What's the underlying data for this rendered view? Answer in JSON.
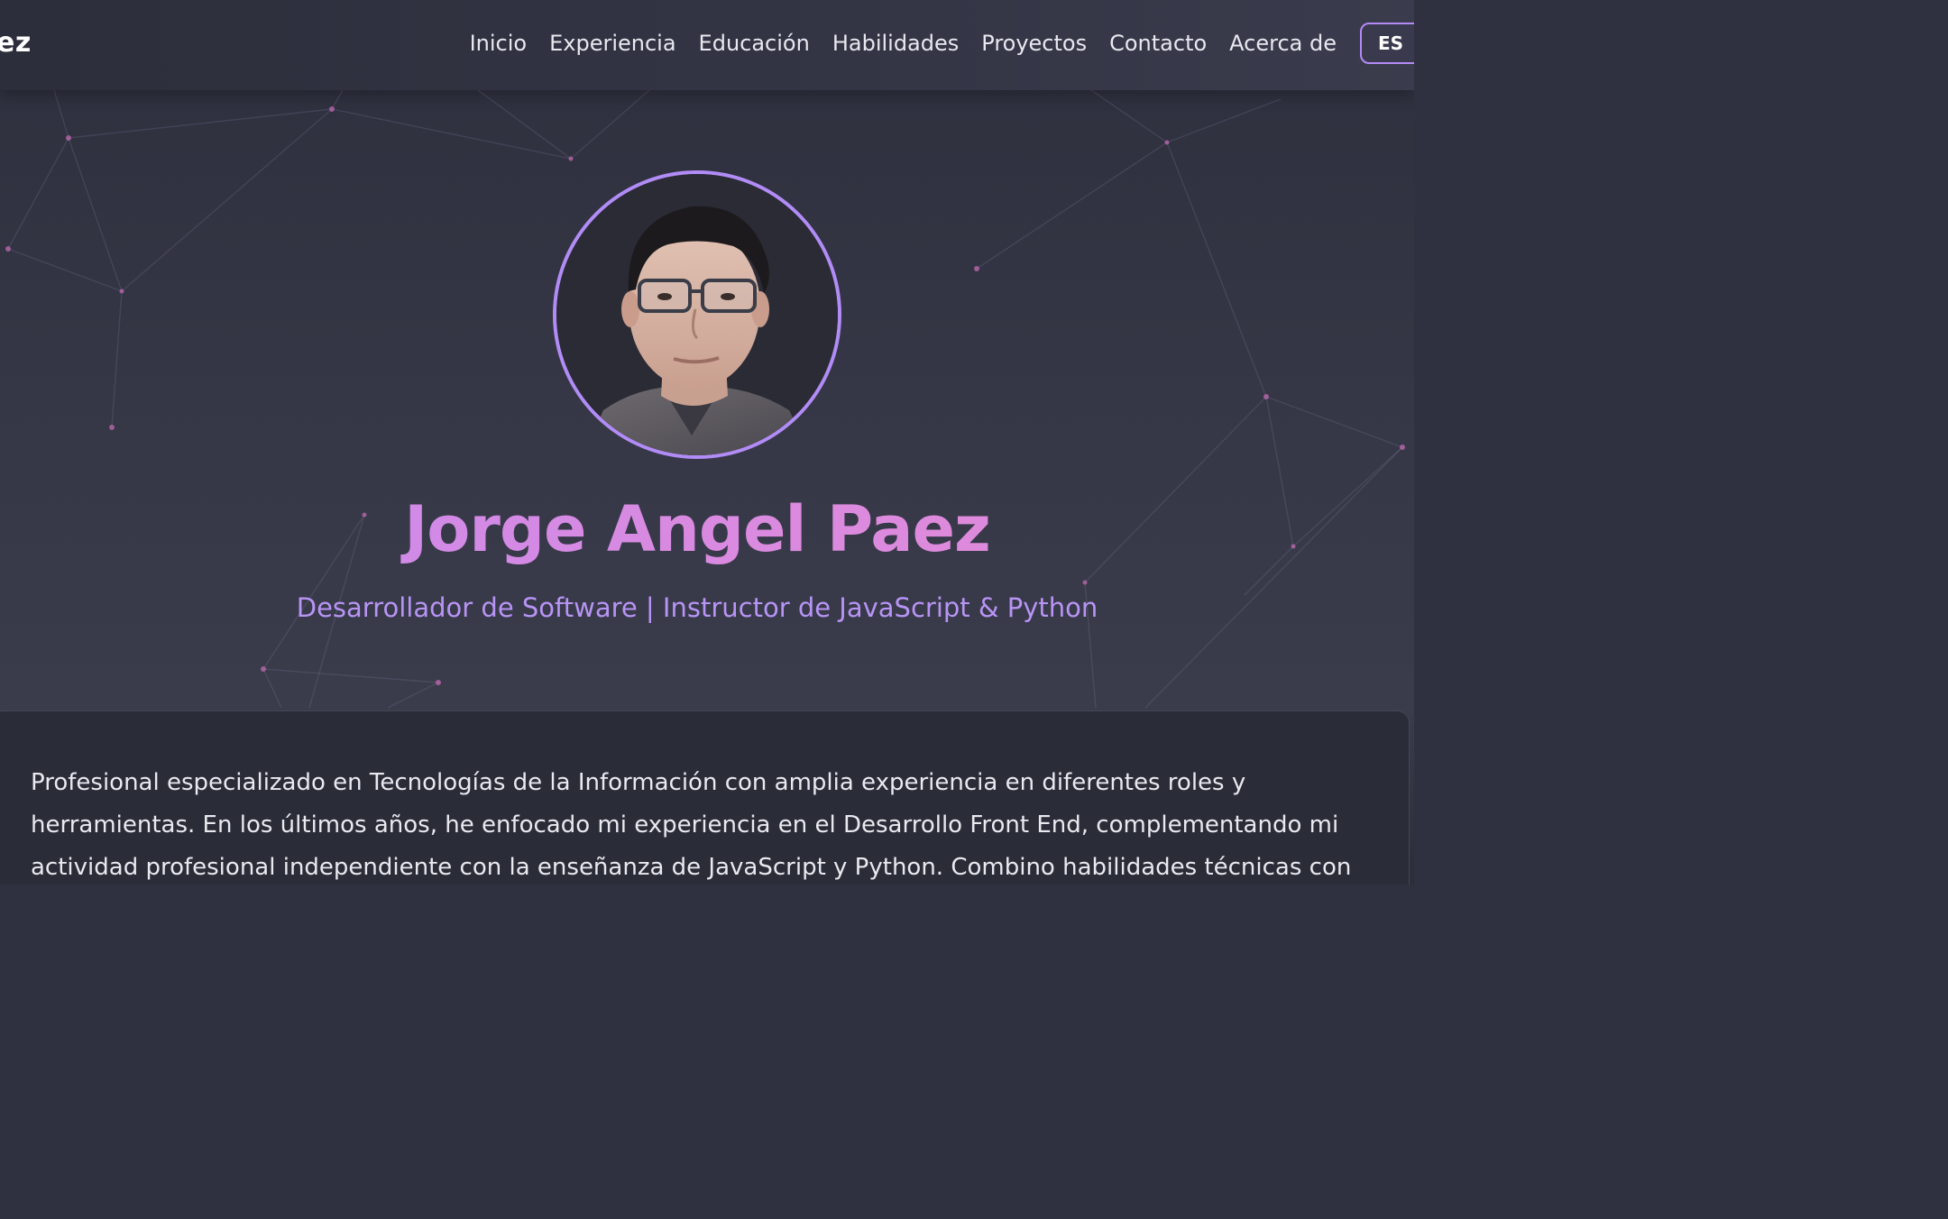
{
  "navbar": {
    "brand": "ez",
    "links": [
      {
        "label": "Inicio"
      },
      {
        "label": "Experiencia"
      },
      {
        "label": "Educación"
      },
      {
        "label": "Habilidades"
      },
      {
        "label": "Proyectos"
      },
      {
        "label": "Contacto"
      },
      {
        "label": "Acerca de"
      }
    ],
    "language": "ES"
  },
  "hero": {
    "name": "Jorge Angel Paez",
    "subtitle": "Desarrollador de Software | Instructor de JavaScript & Python",
    "avatar_alt": "profile-photo"
  },
  "about": {
    "text": "Profesional especializado en Tecnologías de la Información con amplia experiencia en diferentes roles y herramientas. En los últimos años, he enfocado mi experiencia en el Desarrollo Front End, complementando mi actividad profesional independiente con la enseñanza de JavaScript y Python. Combino habilidades técnicas con"
  },
  "colors": {
    "accent": "#b48af5",
    "name_gradient_start": "#c58bf0",
    "name_gradient_end": "#e58bd6",
    "background": "#2f3140"
  }
}
